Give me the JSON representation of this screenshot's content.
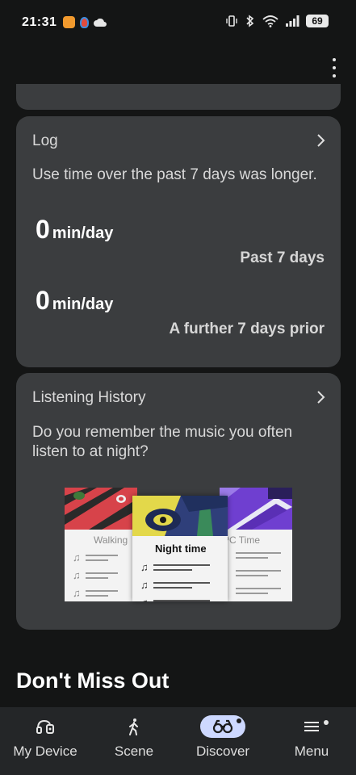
{
  "status_bar": {
    "time": "21:31",
    "battery": "69",
    "icons": [
      "app-orange-icon",
      "app-red-icon",
      "cloud-icon",
      "vibrate-icon",
      "bluetooth-icon",
      "wifi-icon",
      "signal-icon",
      "battery-icon"
    ]
  },
  "log_card": {
    "title": "Log",
    "description": "Use time over the past 7 days was longer.",
    "current": {
      "value": "0",
      "unit": "min/day",
      "label": "Past 7 days"
    },
    "previous": {
      "value": "0",
      "unit": "min/day",
      "label": "A further 7 days prior"
    }
  },
  "history_card": {
    "title": "Listening History",
    "description": "Do you remember the music you often listen to at night?",
    "illustration": {
      "left_caption": "Walking",
      "center_caption": "Night time",
      "right_caption": "PC Time"
    }
  },
  "section": {
    "title": "Don't Miss Out"
  },
  "bottom_nav": {
    "items": [
      {
        "label": "My Device",
        "icon": "headphones-device-icon",
        "active": false
      },
      {
        "label": "Scene",
        "icon": "walking-person-icon",
        "active": false
      },
      {
        "label": "Discover",
        "icon": "binoculars-icon",
        "active": true
      },
      {
        "label": "Menu",
        "icon": "hamburger-menu-icon",
        "active": false
      }
    ]
  },
  "colors": {
    "background": "#141515",
    "card": "#3b3d3f",
    "nav": "#242628",
    "active_pill": "#cdd8ff"
  }
}
